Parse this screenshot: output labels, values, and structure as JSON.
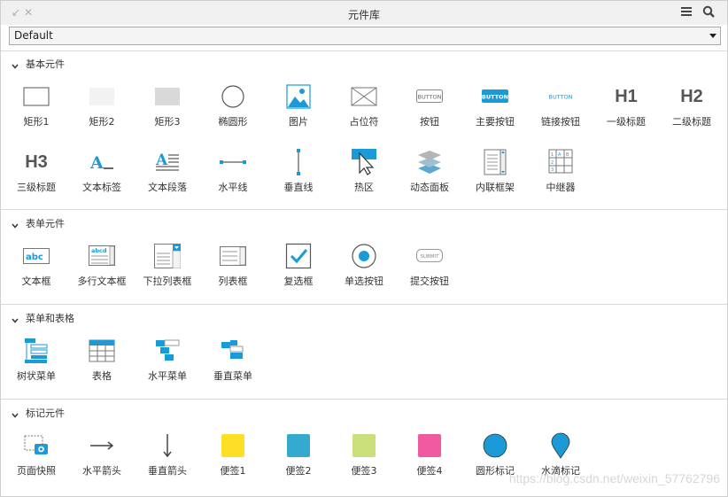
{
  "window": {
    "title": "元件库"
  },
  "library_select": {
    "value": "Default"
  },
  "sections": [
    {
      "title": "基本元件",
      "items": [
        {
          "label": "矩形1",
          "icon": "rectangle-icon"
        },
        {
          "label": "矩形2",
          "icon": "rectangle-filled-light-icon"
        },
        {
          "label": "矩形3",
          "icon": "rectangle-filled-gray-icon"
        },
        {
          "label": "椭圆形",
          "icon": "ellipse-icon"
        },
        {
          "label": "图片",
          "icon": "image-icon"
        },
        {
          "label": "占位符",
          "icon": "placeholder-icon"
        },
        {
          "label": "按钮",
          "icon": "button-icon",
          "text": "BUTTON"
        },
        {
          "label": "主要按钮",
          "icon": "primary-button-icon",
          "text": "BUTTON"
        },
        {
          "label": "链接按钮",
          "icon": "link-button-icon",
          "text": "BUTTON"
        },
        {
          "label": "一级标题",
          "icon": "heading1-icon",
          "text": "H1"
        },
        {
          "label": "二级标题",
          "icon": "heading2-icon",
          "text": "H2"
        },
        {
          "label": "三级标题",
          "icon": "heading3-icon",
          "text": "H3"
        },
        {
          "label": "文本标签",
          "icon": "text-label-icon"
        },
        {
          "label": "文本段落",
          "icon": "text-paragraph-icon"
        },
        {
          "label": "水平线",
          "icon": "horizontal-line-icon"
        },
        {
          "label": "垂直线",
          "icon": "vertical-line-icon"
        },
        {
          "label": "热区",
          "icon": "hotspot-icon"
        },
        {
          "label": "动态面板",
          "icon": "dynamic-panel-icon"
        },
        {
          "label": "内联框架",
          "icon": "inline-frame-icon"
        },
        {
          "label": "中继器",
          "icon": "repeater-icon"
        }
      ]
    },
    {
      "title": "表单元件",
      "items": [
        {
          "label": "文本框",
          "icon": "text-field-icon",
          "text": "abc"
        },
        {
          "label": "多行文本框",
          "icon": "text-area-icon",
          "text": "abcd"
        },
        {
          "label": "下拉列表框",
          "icon": "droplist-icon"
        },
        {
          "label": "列表框",
          "icon": "list-box-icon"
        },
        {
          "label": "复选框",
          "icon": "checkbox-icon"
        },
        {
          "label": "单选按钮",
          "icon": "radio-button-icon"
        },
        {
          "label": "提交按钮",
          "icon": "submit-button-icon",
          "text": "SUBMIT"
        }
      ]
    },
    {
      "title": "菜单和表格",
      "items": [
        {
          "label": "树状菜单",
          "icon": "tree-menu-icon"
        },
        {
          "label": "表格",
          "icon": "table-icon"
        },
        {
          "label": "水平菜单",
          "icon": "horizontal-menu-icon"
        },
        {
          "label": "垂直菜单",
          "icon": "vertical-menu-icon"
        }
      ]
    },
    {
      "title": "标记元件",
      "items": [
        {
          "label": "页面快照",
          "icon": "snapshot-icon"
        },
        {
          "label": "水平箭头",
          "icon": "horizontal-arrow-icon"
        },
        {
          "label": "垂直箭头",
          "icon": "vertical-arrow-icon"
        },
        {
          "label": "便签1",
          "icon": "sticky-yellow-icon"
        },
        {
          "label": "便签2",
          "icon": "sticky-blue-icon"
        },
        {
          "label": "便签3",
          "icon": "sticky-green-icon"
        },
        {
          "label": "便签4",
          "icon": "sticky-pink-icon"
        },
        {
          "label": "圆形标记",
          "icon": "circle-marker-icon"
        },
        {
          "label": "水滴标记",
          "icon": "drop-marker-icon"
        }
      ]
    }
  ],
  "colors": {
    "accent": "#1a9ad6",
    "sticky_yellow": "#ffdf25",
    "sticky_blue": "#36a9ce",
    "sticky_green": "#c8df7a",
    "sticky_pink": "#f15aa0"
  },
  "watermark": "https://blog.csdn.net/weixin_57762796"
}
